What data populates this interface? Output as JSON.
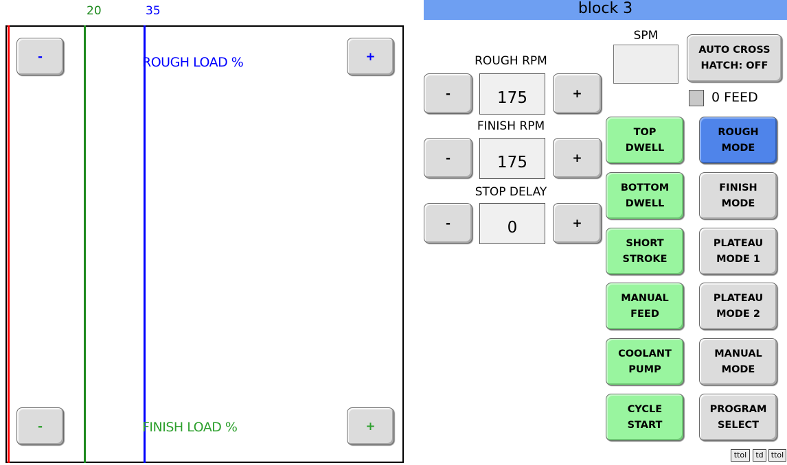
{
  "load_chart": {
    "markers": [
      {
        "label": "20",
        "color": "#1e8a1e"
      },
      {
        "label": "35",
        "color": "#0000ff"
      }
    ],
    "left_line_color": "#ff0000",
    "rough_label": "ROUGH LOAD %",
    "rough_color": "#0000ff",
    "finish_label": "FINISH LOAD %",
    "finish_color": "#2ea02e",
    "rough_minus": "-",
    "rough_plus": "+",
    "finish_minus": "-",
    "finish_plus": "+"
  },
  "panel": {
    "title": "block 3",
    "spm_label": "SPM",
    "auto_cross_hatch": "AUTO CROSS\nHATCH: OFF",
    "zero_feed_label": "0 FEED",
    "controls": [
      {
        "label": "ROUGH RPM",
        "value": "175",
        "minus": "-",
        "plus": "+"
      },
      {
        "label": "FINISH RPM",
        "value": "175",
        "minus": "-",
        "plus": "+"
      },
      {
        "label": "STOP DELAY",
        "value": "0",
        "minus": "-",
        "plus": "+"
      }
    ],
    "green_buttons": [
      "TOP\nDWELL",
      "BOTTOM\nDWELL",
      "SHORT\nSTROKE",
      "MANUAL\nFEED",
      "COOLANT\nPUMP",
      "CYCLE\nSTART"
    ],
    "mode_buttons": [
      "ROUGH\nMODE",
      "FINISH\nMODE",
      "PLATEAU\nMODE 1",
      "PLATEAU\nMODE 2",
      "MANUAL\nMODE",
      "PROGRAM\nSELECT"
    ],
    "active_mode_color": "#4f84ea",
    "green_color": "#99f59f",
    "footer_tags": [
      "ttol",
      "td",
      "ttol"
    ]
  }
}
